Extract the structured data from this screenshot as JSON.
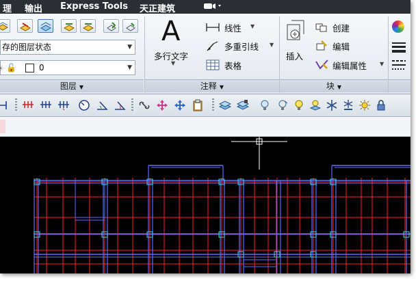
{
  "menu": {
    "items": [
      "理",
      "输出",
      "Express Tools",
      "天正建筑"
    ]
  },
  "ribbon": {
    "layer_panel": {
      "title": "图层",
      "layer_state_combo": "存的图层状态",
      "layer_combo_value": "0"
    },
    "annotation_panel": {
      "title": "注释",
      "multiline_text_label": "多行文字",
      "linear_label": "线性",
      "multileader_label": "多重引线",
      "table_label": "表格"
    },
    "block_panel": {
      "title": "块",
      "insert_label": "插入",
      "create_label": "创建",
      "edit_label": "编辑",
      "edit_attributes_label": "编辑属性"
    }
  },
  "colors": {
    "menubar": "#2b2f35",
    "canvas": "#000000",
    "grid_red": "#ff2020",
    "wall_blue": "#5a6cff",
    "grip_cyan": "#4fd1e0"
  }
}
